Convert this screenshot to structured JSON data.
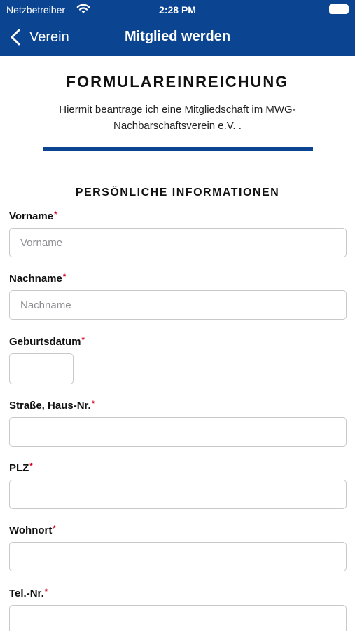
{
  "status_bar": {
    "carrier": "Netzbetreiber",
    "time": "2:28 PM"
  },
  "nav": {
    "back_label": "Verein",
    "title": "Mitglied werden"
  },
  "form": {
    "title": "FORMULAREINREICHUNG",
    "intro": "Hiermit beantrage ich eine Mitgliedschaft im MWG-Nachbarschaftsverein e.V. .",
    "section_title": "PERSÖNLICHE INFORMATIONEN",
    "required_marker": "*",
    "fields": {
      "vorname": {
        "label": "Vorname",
        "placeholder": "Vorname",
        "value": ""
      },
      "nachname": {
        "label": "Nachname",
        "placeholder": "Nachname",
        "value": ""
      },
      "geburtsdatum": {
        "label": "Geburtsdatum",
        "value": ""
      },
      "strasse": {
        "label": "Straße, Haus-Nr.",
        "value": ""
      },
      "plz": {
        "label": "PLZ",
        "value": ""
      },
      "wohnort": {
        "label": "Wohnort",
        "value": ""
      },
      "telefon": {
        "label": "Tel.-Nr.",
        "value": ""
      }
    }
  },
  "colors": {
    "brand_blue": "#0b4591",
    "required_red": "#d0021b"
  },
  "icons": {
    "wifi": "wifi-icon",
    "battery": "battery-icon",
    "back": "chevron-left-icon"
  }
}
